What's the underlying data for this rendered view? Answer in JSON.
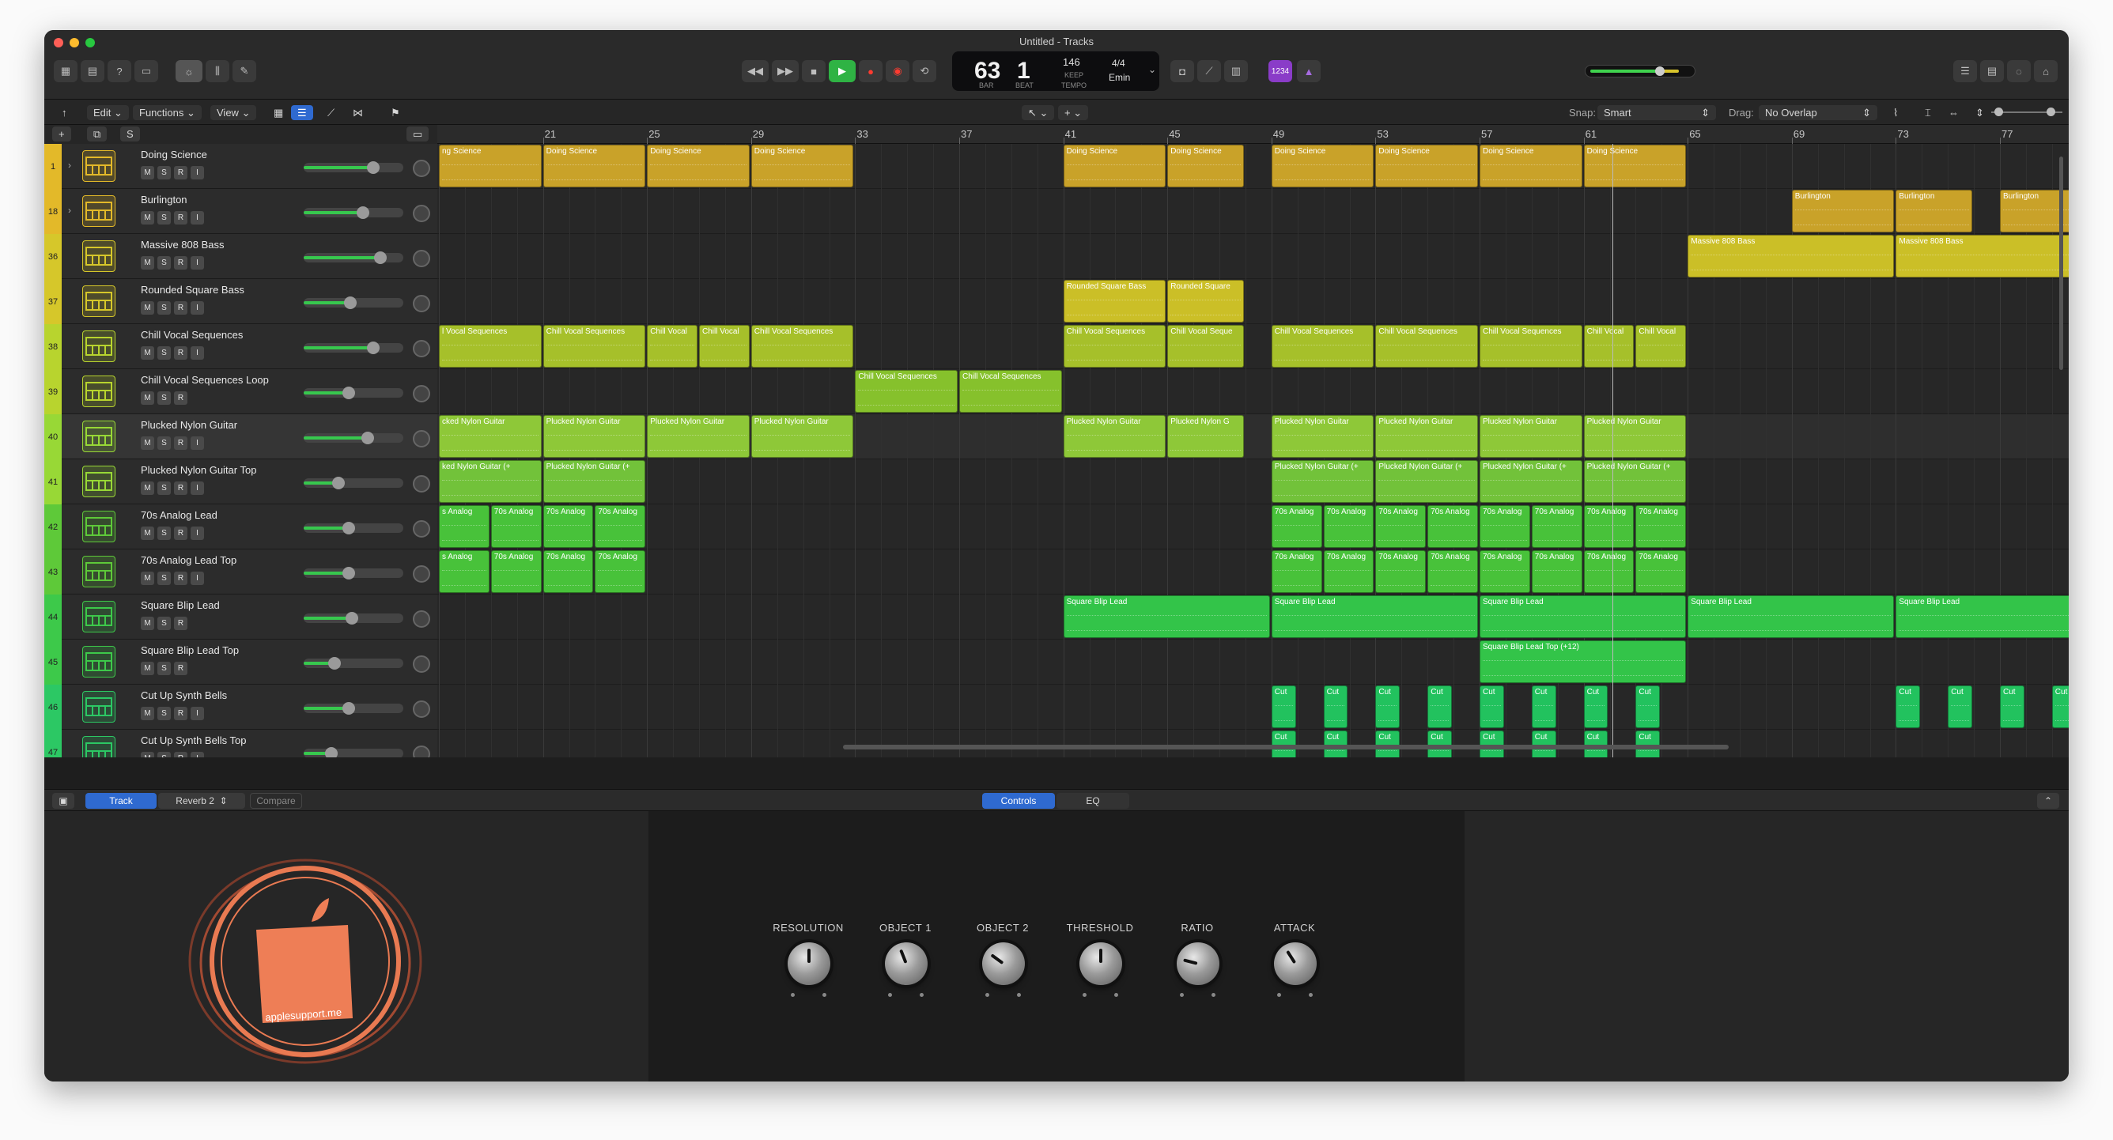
{
  "window": {
    "title": "Untitled - Tracks"
  },
  "transport": {
    "bar": "63",
    "beat": "1",
    "bar_label": "BAR",
    "beat_label": "BEAT",
    "tempo": "146",
    "tempo_sub": "KEEP",
    "tempo_label": "TEMPO",
    "signature": "4/4",
    "key": "Emin",
    "count_in": "1234"
  },
  "menubar": {
    "edit": "Edit",
    "functions": "Functions",
    "view": "View",
    "snap_label": "Snap:",
    "snap_value": "Smart",
    "drag_label": "Drag:",
    "drag_value": "No Overlap"
  },
  "track_header": {
    "add": "+",
    "s_button": "S"
  },
  "ruler": [
    "21",
    "25",
    "29",
    "33",
    "37",
    "41",
    "45",
    "49",
    "53",
    "57",
    "61",
    "65",
    "69",
    "73",
    "77"
  ],
  "tracks": [
    {
      "num": "1",
      "name": "Doing Science",
      "buttons": [
        "M",
        "S",
        "R",
        "I"
      ],
      "color": "#e3b929",
      "vol": 0.78,
      "icon": "drum-machine-icon"
    },
    {
      "num": "18",
      "name": "Burlington",
      "buttons": [
        "M",
        "S",
        "R",
        "I"
      ],
      "color": "#e3b929",
      "vol": 0.66,
      "icon": "drum-machine-icon"
    },
    {
      "num": "36",
      "name": "Massive 808 Bass",
      "buttons": [
        "M",
        "S",
        "R",
        "I"
      ],
      "color": "#d6c72a",
      "vol": 0.86,
      "icon": "synth-keyboard-icon"
    },
    {
      "num": "37",
      "name": "Rounded Square Bass",
      "buttons": [
        "M",
        "S",
        "R",
        "I"
      ],
      "color": "#d6c72a",
      "vol": 0.52,
      "icon": "synth-keyboard-icon"
    },
    {
      "num": "38",
      "name": "Chill Vocal Sequences",
      "buttons": [
        "M",
        "S",
        "R",
        "I"
      ],
      "color": "#b8d42e",
      "vol": 0.78,
      "icon": "synth-keyboard-icon"
    },
    {
      "num": "39",
      "name": "Chill Vocal Sequences Loop",
      "buttons": [
        "M",
        "S",
        "R"
      ],
      "color": "#b8d42e",
      "vol": 0.5,
      "icon": "synth-keyboard-icon"
    },
    {
      "num": "40",
      "name": "Plucked Nylon Guitar",
      "buttons": [
        "M",
        "S",
        "R",
        "I"
      ],
      "color": "#98d836",
      "vol": 0.72,
      "icon": "guitar-stand-icon"
    },
    {
      "num": "41",
      "name": "Plucked Nylon Guitar Top",
      "buttons": [
        "M",
        "S",
        "R",
        "I"
      ],
      "color": "#98d836",
      "vol": 0.38,
      "icon": "guitar-stand-icon"
    },
    {
      "num": "42",
      "name": "70s Analog Lead",
      "buttons": [
        "M",
        "S",
        "R",
        "I"
      ],
      "color": "#5ec939",
      "vol": 0.5,
      "icon": "guitar-stand-icon"
    },
    {
      "num": "43",
      "name": "70s Analog Lead Top",
      "buttons": [
        "M",
        "S",
        "R",
        "I"
      ],
      "color": "#5ec939",
      "vol": 0.5,
      "icon": "guitar-stand-icon"
    },
    {
      "num": "44",
      "name": "Square Blip Lead",
      "buttons": [
        "M",
        "S",
        "R"
      ],
      "color": "#3dc94a",
      "vol": 0.54,
      "icon": "synth-grid-icon"
    },
    {
      "num": "45",
      "name": "Square Blip Lead Top",
      "buttons": [
        "M",
        "S",
        "R"
      ],
      "color": "#3dc94a",
      "vol": 0.34,
      "icon": "synth-grid-icon"
    },
    {
      "num": "46",
      "name": "Cut Up Synth Bells",
      "buttons": [
        "M",
        "S",
        "R",
        "I"
      ],
      "color": "#2cc864",
      "vol": 0.5,
      "icon": "synth-grid-icon"
    },
    {
      "num": "47",
      "name": "Cut Up Synth Bells Top",
      "buttons": [
        "M",
        "S",
        "R",
        "I"
      ],
      "color": "#2cc864",
      "vol": 0.3,
      "icon": "synth-grid-icon"
    }
  ],
  "regions": [
    {
      "lane": 0,
      "bar": 17,
      "len": 4,
      "label": "ng Science",
      "color": "#c9a229"
    },
    {
      "lane": 0,
      "bar": 21,
      "len": 4,
      "label": "Doing Science",
      "color": "#c9a229"
    },
    {
      "lane": 0,
      "bar": 25,
      "len": 4,
      "label": "Doing Science",
      "color": "#c9a229"
    },
    {
      "lane": 0,
      "bar": 29,
      "len": 4,
      "label": "Doing Science",
      "color": "#c9a229"
    },
    {
      "lane": 0,
      "bar": 41,
      "len": 4,
      "label": "Doing Science",
      "color": "#c9a229"
    },
    {
      "lane": 0,
      "bar": 45,
      "len": 3,
      "label": "Doing Science",
      "color": "#c9a229"
    },
    {
      "lane": 0,
      "bar": 49,
      "len": 4,
      "label": "Doing Science",
      "color": "#c9a229"
    },
    {
      "lane": 0,
      "bar": 53,
      "len": 4,
      "label": "Doing Science",
      "color": "#c9a229"
    },
    {
      "lane": 0,
      "bar": 57,
      "len": 4,
      "label": "Doing Science",
      "color": "#c9a229"
    },
    {
      "lane": 0,
      "bar": 61,
      "len": 4,
      "label": "Doing Science",
      "color": "#c9a229"
    },
    {
      "lane": 1,
      "bar": 69,
      "len": 4,
      "label": "Burlington",
      "color": "#c9a229"
    },
    {
      "lane": 1,
      "bar": 73,
      "len": 3,
      "label": "Burlington",
      "color": "#c9a229"
    },
    {
      "lane": 1,
      "bar": 77,
      "len": 3,
      "label": "Burlington",
      "color": "#c9a229"
    },
    {
      "lane": 2,
      "bar": 65,
      "len": 8,
      "label": "Massive 808 Bass",
      "color": "#cbbf27"
    },
    {
      "lane": 2,
      "bar": 73,
      "len": 7,
      "label": "Massive 808 Bass",
      "color": "#cbbf27"
    },
    {
      "lane": 3,
      "bar": 41,
      "len": 4,
      "label": "Rounded Square Bass",
      "color": "#cbbf27"
    },
    {
      "lane": 3,
      "bar": 45,
      "len": 3,
      "label": "Rounded Square",
      "color": "#cbbf27"
    },
    {
      "lane": 4,
      "bar": 17,
      "len": 4,
      "label": "l Vocal Sequences",
      "color": "#a6c02a"
    },
    {
      "lane": 4,
      "bar": 21,
      "len": 4,
      "label": "Chill Vocal Sequences",
      "color": "#a6c02a"
    },
    {
      "lane": 4,
      "bar": 25,
      "len": 2,
      "label": "Chill Vocal",
      "color": "#a6c02a"
    },
    {
      "lane": 4,
      "bar": 27,
      "len": 2,
      "label": "Chill Vocal",
      "color": "#a6c02a"
    },
    {
      "lane": 4,
      "bar": 29,
      "len": 4,
      "label": "Chill Vocal Sequences",
      "color": "#a6c02a"
    },
    {
      "lane": 4,
      "bar": 41,
      "len": 4,
      "label": "Chill Vocal Sequences",
      "color": "#a6c02a"
    },
    {
      "lane": 4,
      "bar": 45,
      "len": 3,
      "label": "Chill Vocal Seque",
      "color": "#a6c02a"
    },
    {
      "lane": 4,
      "bar": 49,
      "len": 4,
      "label": "Chill Vocal Sequences",
      "color": "#a6c02a"
    },
    {
      "lane": 4,
      "bar": 53,
      "len": 4,
      "label": "Chill Vocal Sequences",
      "color": "#a6c02a"
    },
    {
      "lane": 4,
      "bar": 57,
      "len": 4,
      "label": "Chill Vocal Sequences",
      "color": "#a6c02a"
    },
    {
      "lane": 4,
      "bar": 61,
      "len": 2,
      "label": "Chill Vocal",
      "color": "#a6c02a"
    },
    {
      "lane": 4,
      "bar": 63,
      "len": 2,
      "label": "Chill Vocal",
      "color": "#a6c02a"
    },
    {
      "lane": 5,
      "bar": 33,
      "len": 4,
      "label": "Chill Vocal Sequences",
      "color": "#86c12c"
    },
    {
      "lane": 5,
      "bar": 37,
      "len": 4,
      "label": "Chill Vocal Sequences",
      "color": "#86c12c"
    },
    {
      "lane": 6,
      "bar": 17,
      "len": 4,
      "label": "cked Nylon Guitar",
      "color": "#8ec838"
    },
    {
      "lane": 6,
      "bar": 21,
      "len": 4,
      "label": "Plucked Nylon Guitar",
      "color": "#8ec838"
    },
    {
      "lane": 6,
      "bar": 25,
      "len": 4,
      "label": "Plucked Nylon Guitar",
      "color": "#8ec838"
    },
    {
      "lane": 6,
      "bar": 29,
      "len": 4,
      "label": "Plucked Nylon Guitar",
      "color": "#8ec838"
    },
    {
      "lane": 6,
      "bar": 41,
      "len": 4,
      "label": "Plucked Nylon Guitar",
      "color": "#8ec838"
    },
    {
      "lane": 6,
      "bar": 45,
      "len": 3,
      "label": "Plucked Nylon G",
      "color": "#8ec838"
    },
    {
      "lane": 6,
      "bar": 49,
      "len": 4,
      "label": "Plucked Nylon Guitar",
      "color": "#8ec838"
    },
    {
      "lane": 6,
      "bar": 53,
      "len": 4,
      "label": "Plucked Nylon Guitar",
      "color": "#8ec838"
    },
    {
      "lane": 6,
      "bar": 57,
      "len": 4,
      "label": "Plucked Nylon Guitar",
      "color": "#8ec838"
    },
    {
      "lane": 6,
      "bar": 61,
      "len": 4,
      "label": "Plucked Nylon Guitar",
      "color": "#8ec838"
    },
    {
      "lane": 7,
      "bar": 17,
      "len": 4,
      "label": "ked Nylon Guitar (+",
      "color": "#72c23a"
    },
    {
      "lane": 7,
      "bar": 21,
      "len": 4,
      "label": "Plucked Nylon Guitar (+",
      "color": "#72c23a"
    },
    {
      "lane": 7,
      "bar": 49,
      "len": 4,
      "label": "Plucked Nylon Guitar (+",
      "color": "#72c23a"
    },
    {
      "lane": 7,
      "bar": 53,
      "len": 4,
      "label": "Plucked Nylon Guitar (+",
      "color": "#72c23a"
    },
    {
      "lane": 7,
      "bar": 57,
      "len": 4,
      "label": "Plucked Nylon Guitar (+",
      "color": "#72c23a"
    },
    {
      "lane": 7,
      "bar": 61,
      "len": 4,
      "label": "Plucked Nylon Guitar (+",
      "color": "#72c23a"
    },
    {
      "lane": 8,
      "bar": 17,
      "len": 2,
      "label": "s Analog",
      "color": "#48c23a"
    },
    {
      "lane": 8,
      "bar": 19,
      "len": 2,
      "label": "70s Analog",
      "color": "#48c23a"
    },
    {
      "lane": 8,
      "bar": 21,
      "len": 2,
      "label": "70s Analog",
      "color": "#48c23a"
    },
    {
      "lane": 8,
      "bar": 23,
      "len": 2,
      "label": "70s Analog",
      "color": "#48c23a"
    },
    {
      "lane": 8,
      "bar": 49,
      "len": 2,
      "label": "70s Analog",
      "color": "#48c23a"
    },
    {
      "lane": 8,
      "bar": 51,
      "len": 2,
      "label": "70s Analog",
      "color": "#48c23a"
    },
    {
      "lane": 8,
      "bar": 53,
      "len": 2,
      "label": "70s Analog",
      "color": "#48c23a"
    },
    {
      "lane": 8,
      "bar": 55,
      "len": 2,
      "label": "70s Analog",
      "color": "#48c23a"
    },
    {
      "lane": 8,
      "bar": 57,
      "len": 2,
      "label": "70s Analog",
      "color": "#48c23a"
    },
    {
      "lane": 8,
      "bar": 59,
      "len": 2,
      "label": "70s Analog",
      "color": "#48c23a"
    },
    {
      "lane": 8,
      "bar": 61,
      "len": 2,
      "label": "70s Analog",
      "color": "#48c23a"
    },
    {
      "lane": 8,
      "bar": 63,
      "len": 2,
      "label": "70s Analog",
      "color": "#48c23a"
    },
    {
      "lane": 9,
      "bar": 17,
      "len": 2,
      "label": "s Analog",
      "color": "#48c23a"
    },
    {
      "lane": 9,
      "bar": 19,
      "len": 2,
      "label": "70s Analog",
      "color": "#48c23a"
    },
    {
      "lane": 9,
      "bar": 21,
      "len": 2,
      "label": "70s Analog",
      "color": "#48c23a"
    },
    {
      "lane": 9,
      "bar": 23,
      "len": 2,
      "label": "70s Analog",
      "color": "#48c23a"
    },
    {
      "lane": 9,
      "bar": 49,
      "len": 2,
      "label": "70s Analog",
      "color": "#48c23a"
    },
    {
      "lane": 9,
      "bar": 51,
      "len": 2,
      "label": "70s Analog",
      "color": "#48c23a"
    },
    {
      "lane": 9,
      "bar": 53,
      "len": 2,
      "label": "70s Analog",
      "color": "#48c23a"
    },
    {
      "lane": 9,
      "bar": 55,
      "len": 2,
      "label": "70s Analog",
      "color": "#48c23a"
    },
    {
      "lane": 9,
      "bar": 57,
      "len": 2,
      "label": "70s Analog",
      "color": "#48c23a"
    },
    {
      "lane": 9,
      "bar": 59,
      "len": 2,
      "label": "70s Analog",
      "color": "#48c23a"
    },
    {
      "lane": 9,
      "bar": 61,
      "len": 2,
      "label": "70s Analog",
      "color": "#48c23a"
    },
    {
      "lane": 9,
      "bar": 63,
      "len": 2,
      "label": "70s Analog",
      "color": "#48c23a"
    },
    {
      "lane": 10,
      "bar": 41,
      "len": 8,
      "label": "Square Blip Lead",
      "color": "#33c449"
    },
    {
      "lane": 10,
      "bar": 49,
      "len": 8,
      "label": "Square Blip Lead",
      "color": "#33c449"
    },
    {
      "lane": 10,
      "bar": 57,
      "len": 8,
      "label": "Square Blip Lead",
      "color": "#33c449"
    },
    {
      "lane": 10,
      "bar": 65,
      "len": 8,
      "label": "Square Blip Lead",
      "color": "#33c449"
    },
    {
      "lane": 10,
      "bar": 73,
      "len": 7,
      "label": "Square Blip Lead",
      "color": "#33c449"
    },
    {
      "lane": 11,
      "bar": 57,
      "len": 8,
      "label": "Square Blip Lead Top (+12)",
      "color": "#33c449"
    },
    {
      "lane": 12,
      "bar": 49,
      "len": 1,
      "label": "Cut",
      "color": "#22c25e"
    },
    {
      "lane": 12,
      "bar": 51,
      "len": 1,
      "label": "Cut",
      "color": "#22c25e"
    },
    {
      "lane": 12,
      "bar": 53,
      "len": 1,
      "label": "Cut",
      "color": "#22c25e"
    },
    {
      "lane": 12,
      "bar": 55,
      "len": 1,
      "label": "Cut",
      "color": "#22c25e"
    },
    {
      "lane": 12,
      "bar": 57,
      "len": 1,
      "label": "Cut",
      "color": "#22c25e"
    },
    {
      "lane": 12,
      "bar": 59,
      "len": 1,
      "label": "Cut",
      "color": "#22c25e"
    },
    {
      "lane": 12,
      "bar": 61,
      "len": 1,
      "label": "Cut",
      "color": "#22c25e"
    },
    {
      "lane": 12,
      "bar": 63,
      "len": 1,
      "label": "Cut",
      "color": "#22c25e"
    },
    {
      "lane": 12,
      "bar": 73,
      "len": 1,
      "label": "Cut",
      "color": "#22c25e"
    },
    {
      "lane": 12,
      "bar": 75,
      "len": 1,
      "label": "Cut",
      "color": "#22c25e"
    },
    {
      "lane": 12,
      "bar": 77,
      "len": 1,
      "label": "Cut",
      "color": "#22c25e"
    },
    {
      "lane": 12,
      "bar": 79,
      "len": 1,
      "label": "Cut",
      "color": "#22c25e"
    },
    {
      "lane": 13,
      "bar": 49,
      "len": 1,
      "label": "Cut",
      "color": "#22c25e"
    },
    {
      "lane": 13,
      "bar": 51,
      "len": 1,
      "label": "Cut",
      "color": "#22c25e"
    },
    {
      "lane": 13,
      "bar": 53,
      "len": 1,
      "label": "Cut",
      "color": "#22c25e"
    },
    {
      "lane": 13,
      "bar": 55,
      "len": 1,
      "label": "Cut",
      "color": "#22c25e"
    },
    {
      "lane": 13,
      "bar": 57,
      "len": 1,
      "label": "Cut",
      "color": "#22c25e"
    },
    {
      "lane": 13,
      "bar": 59,
      "len": 1,
      "label": "Cut",
      "color": "#22c25e"
    },
    {
      "lane": 13,
      "bar": 61,
      "len": 1,
      "label": "Cut",
      "color": "#22c25e"
    },
    {
      "lane": 13,
      "bar": 63,
      "len": 1,
      "label": "Cut",
      "color": "#22c25e"
    }
  ],
  "panel": {
    "track_tab": "Track",
    "preset": "Reverb 2",
    "compare": "Compare",
    "controls_tab": "Controls",
    "eq_tab": "EQ"
  },
  "plugin": {
    "logo_text": "applesupport.me",
    "knobs": [
      {
        "label": "RESOLUTION",
        "value": 0.5
      },
      {
        "label": "OBJECT 1",
        "value": 0.42
      },
      {
        "label": "OBJECT 2",
        "value": 0.3
      },
      {
        "label": "THRESHOLD",
        "value": 0.5
      },
      {
        "label": "RATIO",
        "value": 0.22
      },
      {
        "label": "ATTACK",
        "value": 0.38
      }
    ]
  }
}
